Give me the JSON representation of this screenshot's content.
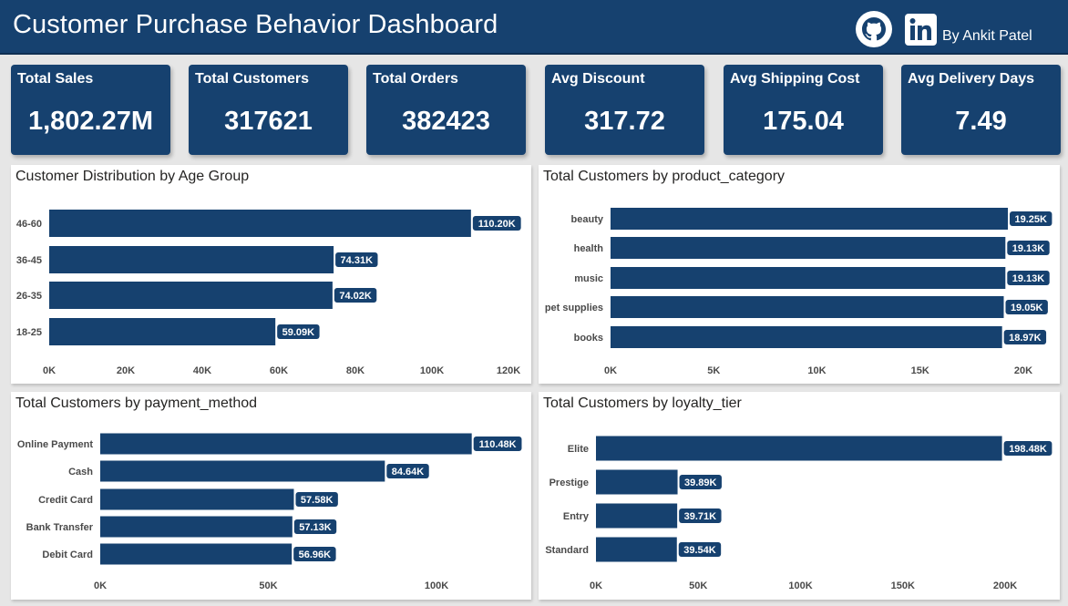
{
  "header": {
    "title": "Customer Purchase Behavior Dashboard",
    "author": "By Ankit Patel",
    "icons": [
      "github-icon",
      "linkedin-icon"
    ]
  },
  "kpis": [
    {
      "label": "Total Sales",
      "value": "1,802.27M"
    },
    {
      "label": "Total Customers",
      "value": "317621"
    },
    {
      "label": "Total Orders",
      "value": "382423"
    },
    {
      "label": "Avg Discount",
      "value": "317.72"
    },
    {
      "label": "Avg Shipping Cost",
      "value": "175.04"
    },
    {
      "label": "Avg Delivery Days",
      "value": "7.49"
    }
  ],
  "colors": {
    "accent": "#16416f",
    "background": "#e6e6e6",
    "panel": "#ffffff"
  },
  "chart_data": [
    {
      "type": "bar",
      "orientation": "horizontal",
      "title": "Customer Distribution by Age Group",
      "categories": [
        "46-60",
        "36-45",
        "26-35",
        "18-25"
      ],
      "values": [
        110200,
        74310,
        74020,
        59090
      ],
      "data_labels": [
        "110.20K",
        "74.31K",
        "74.02K",
        "59.09K"
      ],
      "xlim": [
        0,
        120000
      ],
      "ticks": [
        0,
        20000,
        40000,
        60000,
        80000,
        100000,
        120000
      ],
      "tick_labels": [
        "0K",
        "20K",
        "40K",
        "60K",
        "80K",
        "100K",
        "120K"
      ],
      "grid": false
    },
    {
      "type": "bar",
      "orientation": "horizontal",
      "title": "Total Customers by product_category",
      "categories": [
        "beauty",
        "health",
        "music",
        "pet supplies",
        "books"
      ],
      "values": [
        19250,
        19130,
        19130,
        19050,
        18970
      ],
      "data_labels": [
        "19.25K",
        "19.13K",
        "19.13K",
        "19.05K",
        "18.97K"
      ],
      "xlim": [
        0,
        20000
      ],
      "ticks": [
        0,
        5000,
        10000,
        15000,
        20000
      ],
      "tick_labels": [
        "0K",
        "5K",
        "10K",
        "15K",
        "20K"
      ],
      "grid": false
    },
    {
      "type": "bar",
      "orientation": "horizontal",
      "title": "Total Customers by payment_method",
      "categories": [
        "Online Payment",
        "Cash",
        "Credit Card",
        "Bank Transfer",
        "Debit Card"
      ],
      "values": [
        110480,
        84640,
        57580,
        57130,
        56960
      ],
      "data_labels": [
        "110.48K",
        "84.64K",
        "57.58K",
        "57.13K",
        "56.96K"
      ],
      "xlim": [
        0,
        100000
      ],
      "ticks": [
        0,
        50000,
        100000
      ],
      "tick_labels": [
        "0K",
        "50K",
        "100K"
      ],
      "grid": false
    },
    {
      "type": "bar",
      "orientation": "horizontal",
      "title": "Total Customers by loyalty_tier",
      "categories": [
        "Elite",
        "Prestige",
        "Entry",
        "Standard"
      ],
      "values": [
        198480,
        39890,
        39710,
        39540
      ],
      "data_labels": [
        "198.48K",
        "39.89K",
        "39.71K",
        "39.54K"
      ],
      "xlim": [
        0,
        200000
      ],
      "ticks": [
        0,
        50000,
        100000,
        150000,
        200000
      ],
      "tick_labels": [
        "0K",
        "50K",
        "100K",
        "150K",
        "200K"
      ],
      "grid": false
    }
  ]
}
